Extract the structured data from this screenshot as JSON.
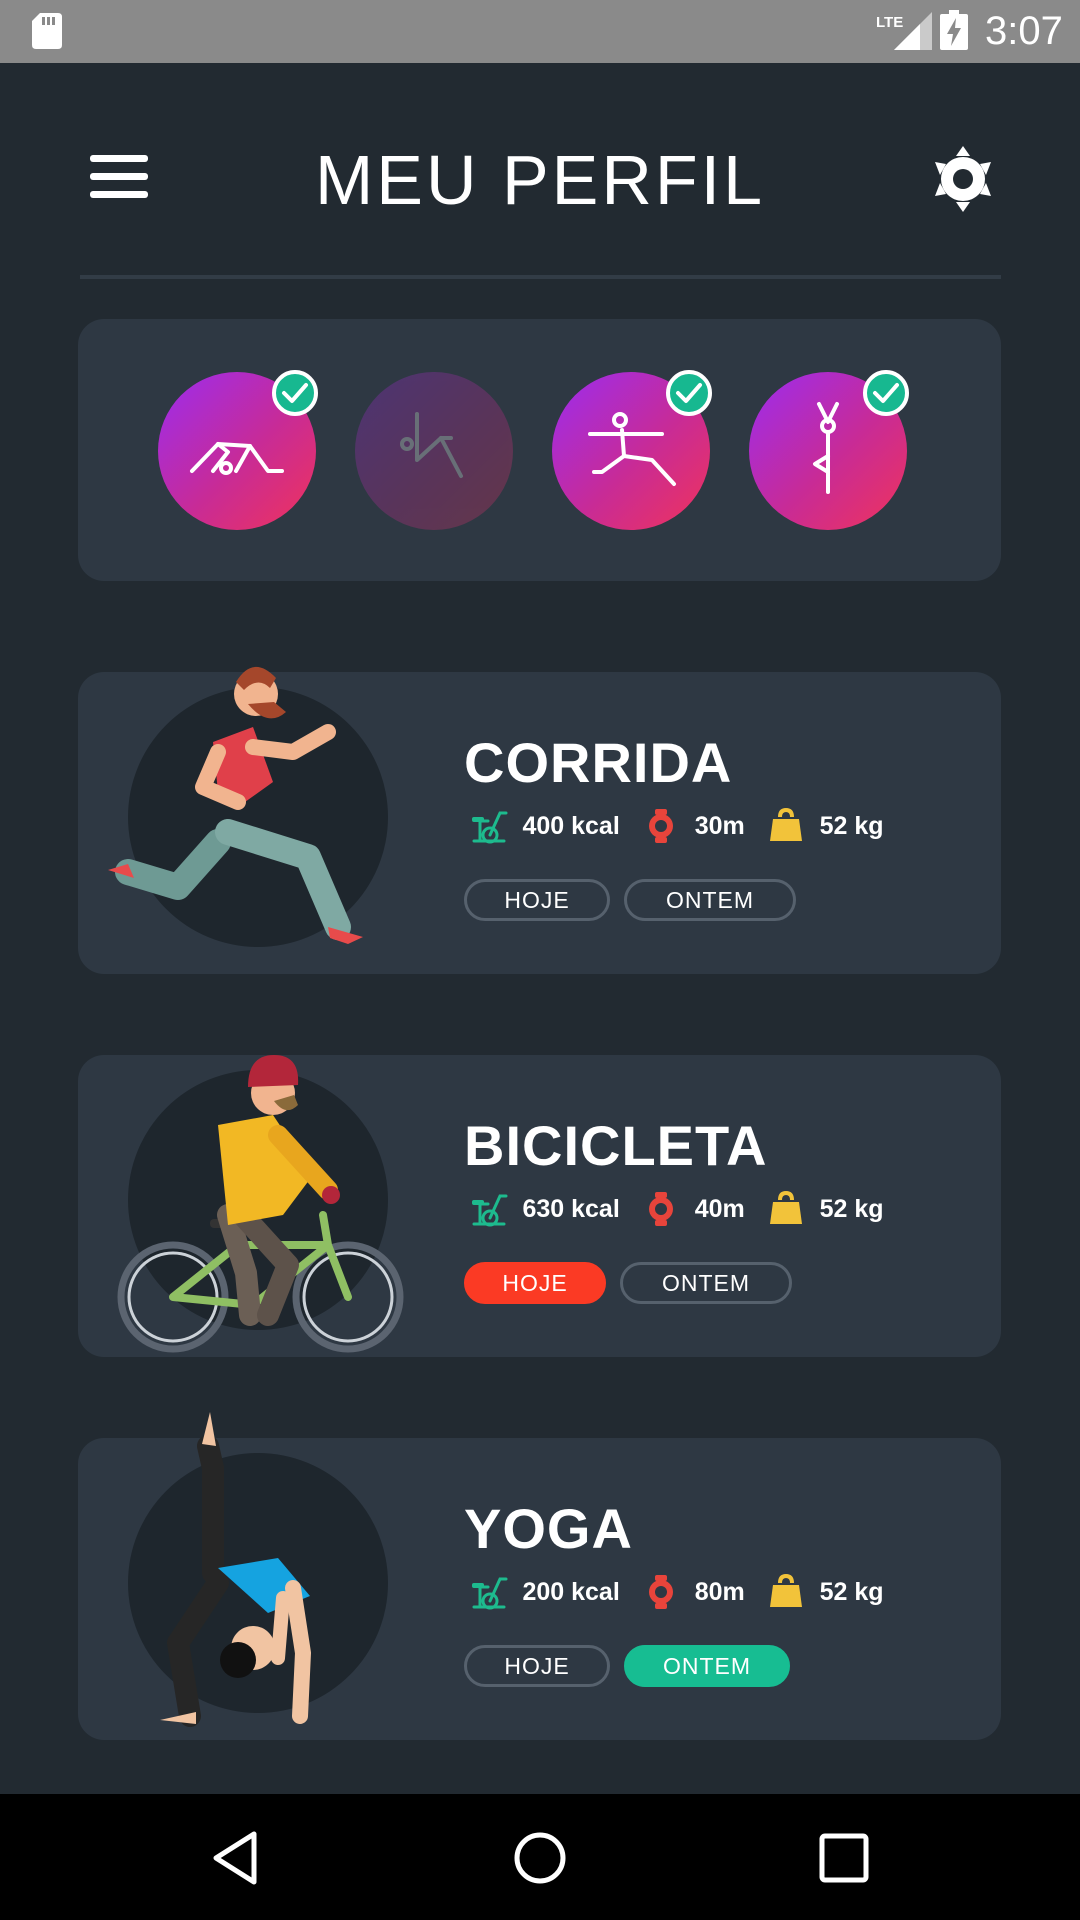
{
  "status_bar": {
    "time": "3:07",
    "network": "LTE",
    "icons": [
      "sd-card-icon",
      "lte-signal-icon",
      "battery-charging-icon"
    ]
  },
  "header": {
    "title": "MEU PERFIL",
    "menu_icon": "hamburger-menu-icon",
    "settings_icon": "gear-icon"
  },
  "achievements": [
    {
      "icon": "yoga-stretch-icon",
      "completed": true
    },
    {
      "icon": "yoga-bend-icon",
      "completed": false
    },
    {
      "icon": "warrior-pose-icon",
      "completed": true
    },
    {
      "icon": "tree-pose-icon",
      "completed": true
    }
  ],
  "activities": [
    {
      "title": "CORRIDA",
      "kcal": "400 kcal",
      "time": "30m",
      "weight": "52 kg",
      "today_label": "HOJE",
      "yesterday_label": "ONTEM",
      "selected": "none"
    },
    {
      "title": "BICICLETA",
      "kcal": "630 kcal",
      "time": "40m",
      "weight": "52 kg",
      "today_label": "HOJE",
      "yesterday_label": "ONTEM",
      "selected": "HOJE"
    },
    {
      "title": "YOGA",
      "kcal": "200 kcal",
      "time": "80m",
      "weight": "52 kg",
      "today_label": "HOJE",
      "yesterday_label": "ONTEM",
      "selected": "ONTEM"
    }
  ],
  "colors": {
    "background": "#222a31",
    "card": "#2e3843",
    "accent_red": "#fb3a24",
    "accent_green": "#17bd92",
    "badge_gradient_start": "#9b2cf0",
    "badge_gradient_end": "#f0335a"
  },
  "nav_bar": {
    "icons": [
      "back-triangle-icon",
      "home-circle-icon",
      "recents-square-icon"
    ]
  }
}
